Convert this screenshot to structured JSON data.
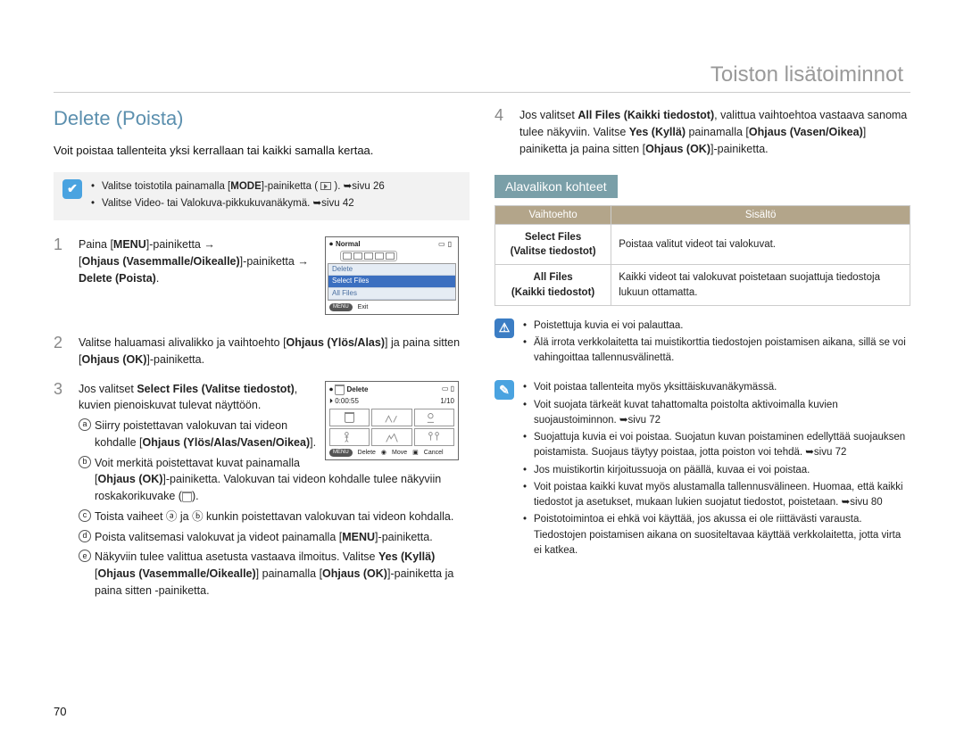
{
  "chapter_title": "Toiston lisätoiminnot",
  "page_number": "70",
  "left": {
    "heading": "Delete (Poista)",
    "intro": "Voit poistaa tallenteita yksi kerrallaan tai kaikki samalla kertaa.",
    "tip": {
      "line1_pre": "Valitse toistotila painamalla [",
      "mode": "MODE",
      "line1_mid": "]-painiketta ( ",
      "line1_post": " ). ",
      "ref1": "➥sivu 26",
      "line2": "Valitse Video- tai Valokuva-pikkukuvanäkymä.",
      "ref2": "➥sivu 42"
    },
    "lcd1": {
      "label_normal": "Normal",
      "menu": [
        "Delete",
        "Select Files",
        "All Files"
      ],
      "btn_menu": "MENU",
      "btn_exit": "Exit"
    },
    "lcd2": {
      "label_delete": "Delete",
      "time": "0:00:55",
      "counter": "1/10",
      "btn_menu": "MENU",
      "btn_delete": "Delete",
      "btn_move": "Move",
      "btn_cancel": "Cancel"
    },
    "steps": [
      {
        "num": "1",
        "t1": "Paina [",
        "b1": "MENU",
        "t2": "]-painiketta →",
        "b2": "Ohjaus (Vasemmalle/Oikealle)",
        "t3": "-painiketta",
        "b3": "Delete (Poista)"
      },
      {
        "num": "2",
        "t1": "Valitse haluamasi alivalikko ja vaihtoehto",
        "b1": "Ohjaus (Ylös/Alas)",
        "t2": "ja paina sitten",
        "b2": "Ohjaus (OK)",
        "t3": "-painiketta."
      },
      {
        "num": "3",
        "t1": "Jos valitset",
        "b1": "Select Files (Valitse tiedostot)",
        "t2": "kuvien pienoiskuvat tulevat näyttöön.",
        "sub": [
          {
            "t1": "Siirry poistettavan valokuvan tai videon kohdalle",
            "b1": "Ohjaus (Ylös/Alas/Vasen/Oikea)"
          },
          {
            "t1": "Voit merkitä poistettavat kuvat painamalla",
            "b1": "Ohjaus (OK)",
            "t2": "-painiketta. Valokuvan tai videon kohdalle tulee näkyviin roskakorikuvake"
          },
          {
            "t1": "Toista vaiheet ⓐ ja ⓑ kunkin poistettavan valokuvan tai videon kohdalla."
          },
          {
            "t1": "Poista valitsemasi valokuvat ja videot painamalla",
            "b1": "MENU",
            "t2": "-painiketta."
          },
          {
            "t1": "Näkyviin tulee valittua asetusta vastaava ilmoitus. Valitse",
            "b1": "Yes (Kyllä)",
            "b2": "Ohjaus (Vasemmalle/Oikealle)",
            "t2": "painamalla",
            "b3": "Ohjaus (OK)",
            "t3": "-painiketta ja paina sitten -painiketta."
          }
        ]
      }
    ]
  },
  "right": {
    "step4": {
      "num": "4",
      "t1": "Jos valitset",
      "b1": "All Files (Kaikki tiedostot)",
      "t2": "valittua vaihtoehtoa vastaava sanoma tulee näkyviin. Valitse",
      "b2": "Yes (Kyllä)",
      "t3": "painamalla",
      "b3": "Ohjaus (Vasen/Oikea)",
      "t4": "painiketta ja paina sitten",
      "b4": "Ohjaus (OK)",
      "t5": "-painiketta."
    },
    "sub_label": "Alavalikon kohteet",
    "table": {
      "head": [
        "Vaihtoehto",
        "Sisältö"
      ],
      "rows": [
        {
          "name_en": "Select Files",
          "name_fi": "Valitse tiedostot",
          "desc": "Poistaa valitut videot tai valokuvat."
        },
        {
          "name_en": "All Files",
          "name_fi": "Kaikki tiedostot",
          "desc": "Kaikki videot tai valokuvat poistetaan suojattuja tiedostoja lukuun ottamatta."
        }
      ]
    },
    "warn": [
      "Poistettuja kuvia ei voi palauttaa.",
      "Älä irrota verkkolaitetta tai muistikorttia tiedostojen poistamisen aikana, sillä se voi vahingoittaa tallennusvälinettä."
    ],
    "notes": [
      "Voit poistaa tallenteita myös yksittäiskuvanäkymässä.",
      "Voit suojata tärkeät kuvat tahattomalta poistolta aktivoimalla kuvien suojaustoiminnon.",
      "Suojattuja kuvia ei voi poistaa. Suojatun kuvan poistaminen edellyttää suojauksen poistamista. Suojaus täytyy poistaa, jotta poiston voi tehdä.",
      "Jos muistikortin kirjoitussuoja on päällä, kuvaa ei voi poistaa.",
      "Voit poistaa kaikki kuvat myös alustamalla tallennusvälineen. Huomaa, että kaikki tiedostot ja asetukset, mukaan lukien suojatut tiedostot, poistetaan.",
      "Poistotoimintoa ei ehkä voi käyttää, jos akussa ei ole riittävästi varausta. Tiedostojen poistamisen aikana on suositeltavaa käyttää verkkolaitetta, jotta virta ei katkea."
    ],
    "refs": [
      "➥sivu 72",
      "➥sivu 72",
      "➥sivu 80"
    ]
  }
}
